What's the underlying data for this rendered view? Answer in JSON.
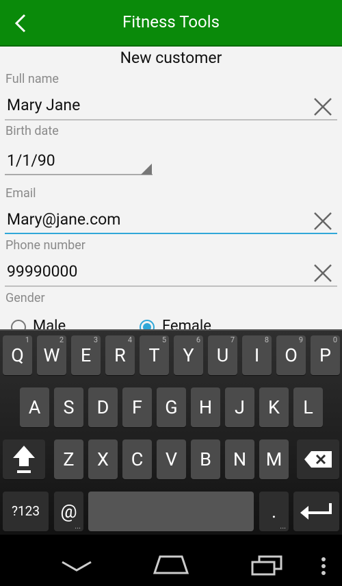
{
  "appbar": {
    "title": "Fitness Tools"
  },
  "form": {
    "heading": "New customer",
    "full_name": {
      "label": "Full name",
      "value": "Mary Jane"
    },
    "birth_date": {
      "label": "Birth date",
      "value": "1/1/90"
    },
    "email": {
      "label": "Email",
      "value": "Mary@jane.com"
    },
    "phone": {
      "label": "Phone number",
      "value": "99990000"
    },
    "gender": {
      "label": "Gender",
      "options": [
        "Male",
        "Female"
      ],
      "selected": "Female"
    }
  },
  "keyboard": {
    "row1": [
      {
        "k": "Q",
        "n": "1"
      },
      {
        "k": "W",
        "n": "2"
      },
      {
        "k": "E",
        "n": "3"
      },
      {
        "k": "R",
        "n": "4"
      },
      {
        "k": "T",
        "n": "5"
      },
      {
        "k": "Y",
        "n": "6"
      },
      {
        "k": "U",
        "n": "7"
      },
      {
        "k": "I",
        "n": "8"
      },
      {
        "k": "O",
        "n": "9"
      },
      {
        "k": "P",
        "n": "0"
      }
    ],
    "row2": [
      "A",
      "S",
      "D",
      "F",
      "G",
      "H",
      "J",
      "K",
      "L"
    ],
    "row3": [
      "Z",
      "X",
      "C",
      "V",
      "B",
      "N",
      "M"
    ],
    "symbols_label": "?123",
    "at_label": "@",
    "period_label": ".",
    "more_dots": "..."
  },
  "colors": {
    "appbar": "#0a8a0a",
    "accent": "#2fa7d8"
  }
}
